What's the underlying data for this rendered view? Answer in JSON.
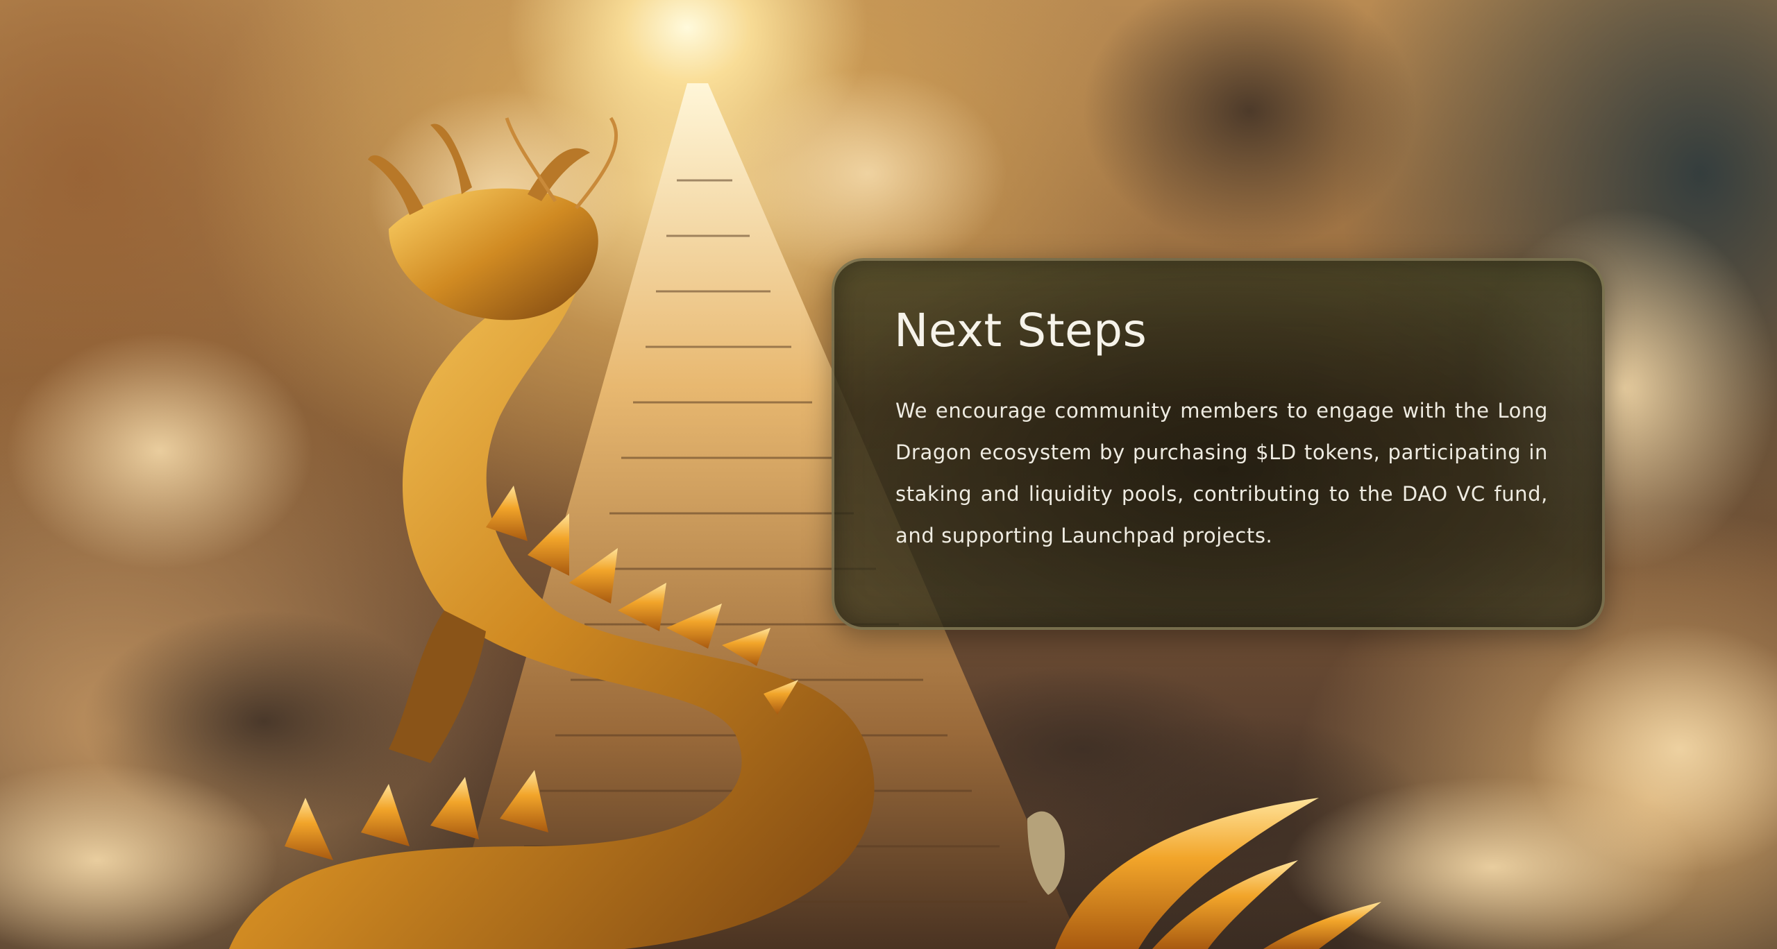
{
  "next_steps": {
    "title": "Next Steps",
    "body": "We encourage community members to engage with the Long Dragon ecosystem by purchasing $LD tokens, participating in staking and liquidity pools, contributing to the DAO VC fund, and supporting Launchpad projects."
  },
  "colors": {
    "card_tint": "#3a3820",
    "card_border": "#a0966e",
    "text": "#f6f3ea",
    "dragon_gold": "#d99a2b",
    "sky_glow": "#fff2c8"
  }
}
